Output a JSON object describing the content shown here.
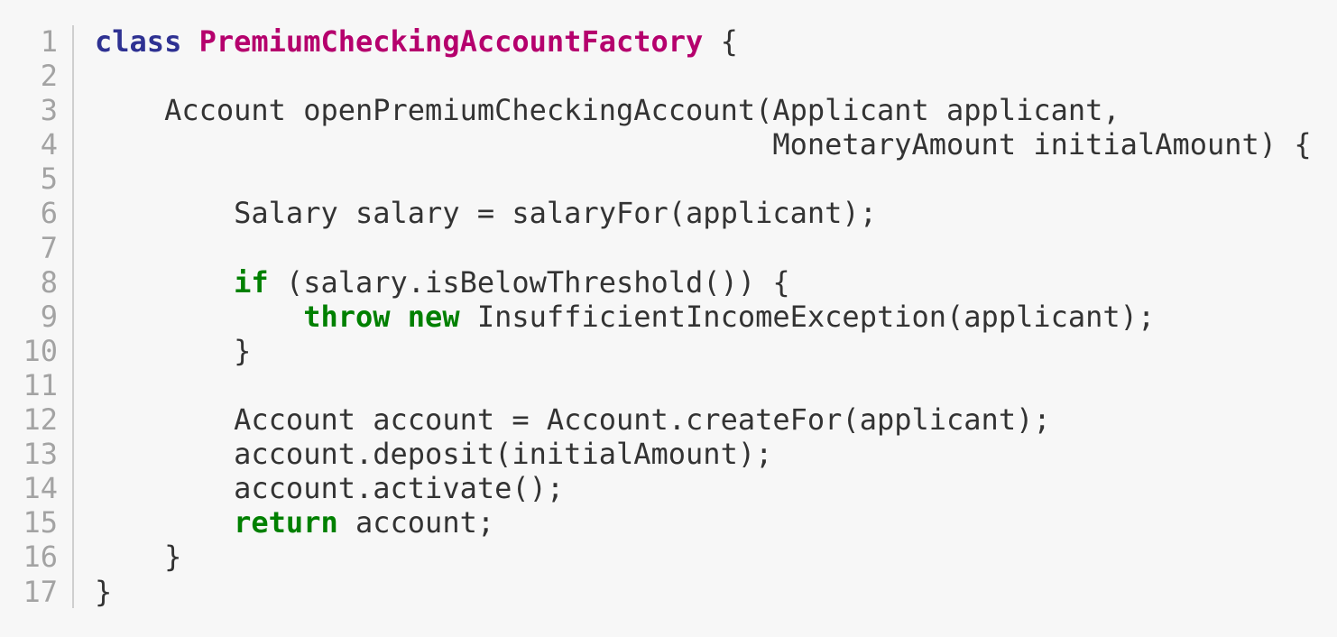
{
  "colors": {
    "background": "#f7f7f7",
    "text": "#333333",
    "line_number": "#a3a3a3",
    "keyword_declaration": "#2e3192",
    "class_name": "#b5006d",
    "keyword_control": "#008000",
    "gutter_rule": "#cfcfcf"
  },
  "line_numbers": [
    "1",
    "2",
    "3",
    "4",
    "5",
    "6",
    "7",
    "8",
    "9",
    "10",
    "11",
    "12",
    "13",
    "14",
    "15",
    "16",
    "17"
  ],
  "lines": [
    {
      "tokens": [
        {
          "kind": "keyword",
          "text": "class"
        },
        {
          "kind": "plain",
          "text": " "
        },
        {
          "kind": "classname",
          "text": "PremiumCheckingAccountFactory"
        },
        {
          "kind": "plain",
          "text": " {"
        }
      ]
    },
    {
      "tokens": []
    },
    {
      "tokens": [
        {
          "kind": "plain",
          "text": "    Account openPremiumCheckingAccount(Applicant applicant,"
        }
      ]
    },
    {
      "tokens": [
        {
          "kind": "plain",
          "text": "                                       MonetaryAmount initialAmount) {"
        }
      ]
    },
    {
      "tokens": []
    },
    {
      "tokens": [
        {
          "kind": "plain",
          "text": "        Salary salary = salaryFor(applicant);"
        }
      ]
    },
    {
      "tokens": []
    },
    {
      "tokens": [
        {
          "kind": "plain",
          "text": "        "
        },
        {
          "kind": "control",
          "text": "if"
        },
        {
          "kind": "plain",
          "text": " (salary.isBelowThreshold()) {"
        }
      ]
    },
    {
      "tokens": [
        {
          "kind": "plain",
          "text": "            "
        },
        {
          "kind": "control",
          "text": "throw"
        },
        {
          "kind": "plain",
          "text": " "
        },
        {
          "kind": "control",
          "text": "new"
        },
        {
          "kind": "plain",
          "text": " InsufficientIncomeException(applicant);"
        }
      ]
    },
    {
      "tokens": [
        {
          "kind": "plain",
          "text": "        }"
        }
      ]
    },
    {
      "tokens": []
    },
    {
      "tokens": [
        {
          "kind": "plain",
          "text": "        Account account = Account.createFor(applicant);"
        }
      ]
    },
    {
      "tokens": [
        {
          "kind": "plain",
          "text": "        account.deposit(initialAmount);"
        }
      ]
    },
    {
      "tokens": [
        {
          "kind": "plain",
          "text": "        account.activate();"
        }
      ]
    },
    {
      "tokens": [
        {
          "kind": "plain",
          "text": "        "
        },
        {
          "kind": "control",
          "text": "return"
        },
        {
          "kind": "plain",
          "text": " account;"
        }
      ]
    },
    {
      "tokens": [
        {
          "kind": "plain",
          "text": "    }"
        }
      ]
    },
    {
      "tokens": [
        {
          "kind": "plain",
          "text": "}"
        }
      ]
    }
  ]
}
